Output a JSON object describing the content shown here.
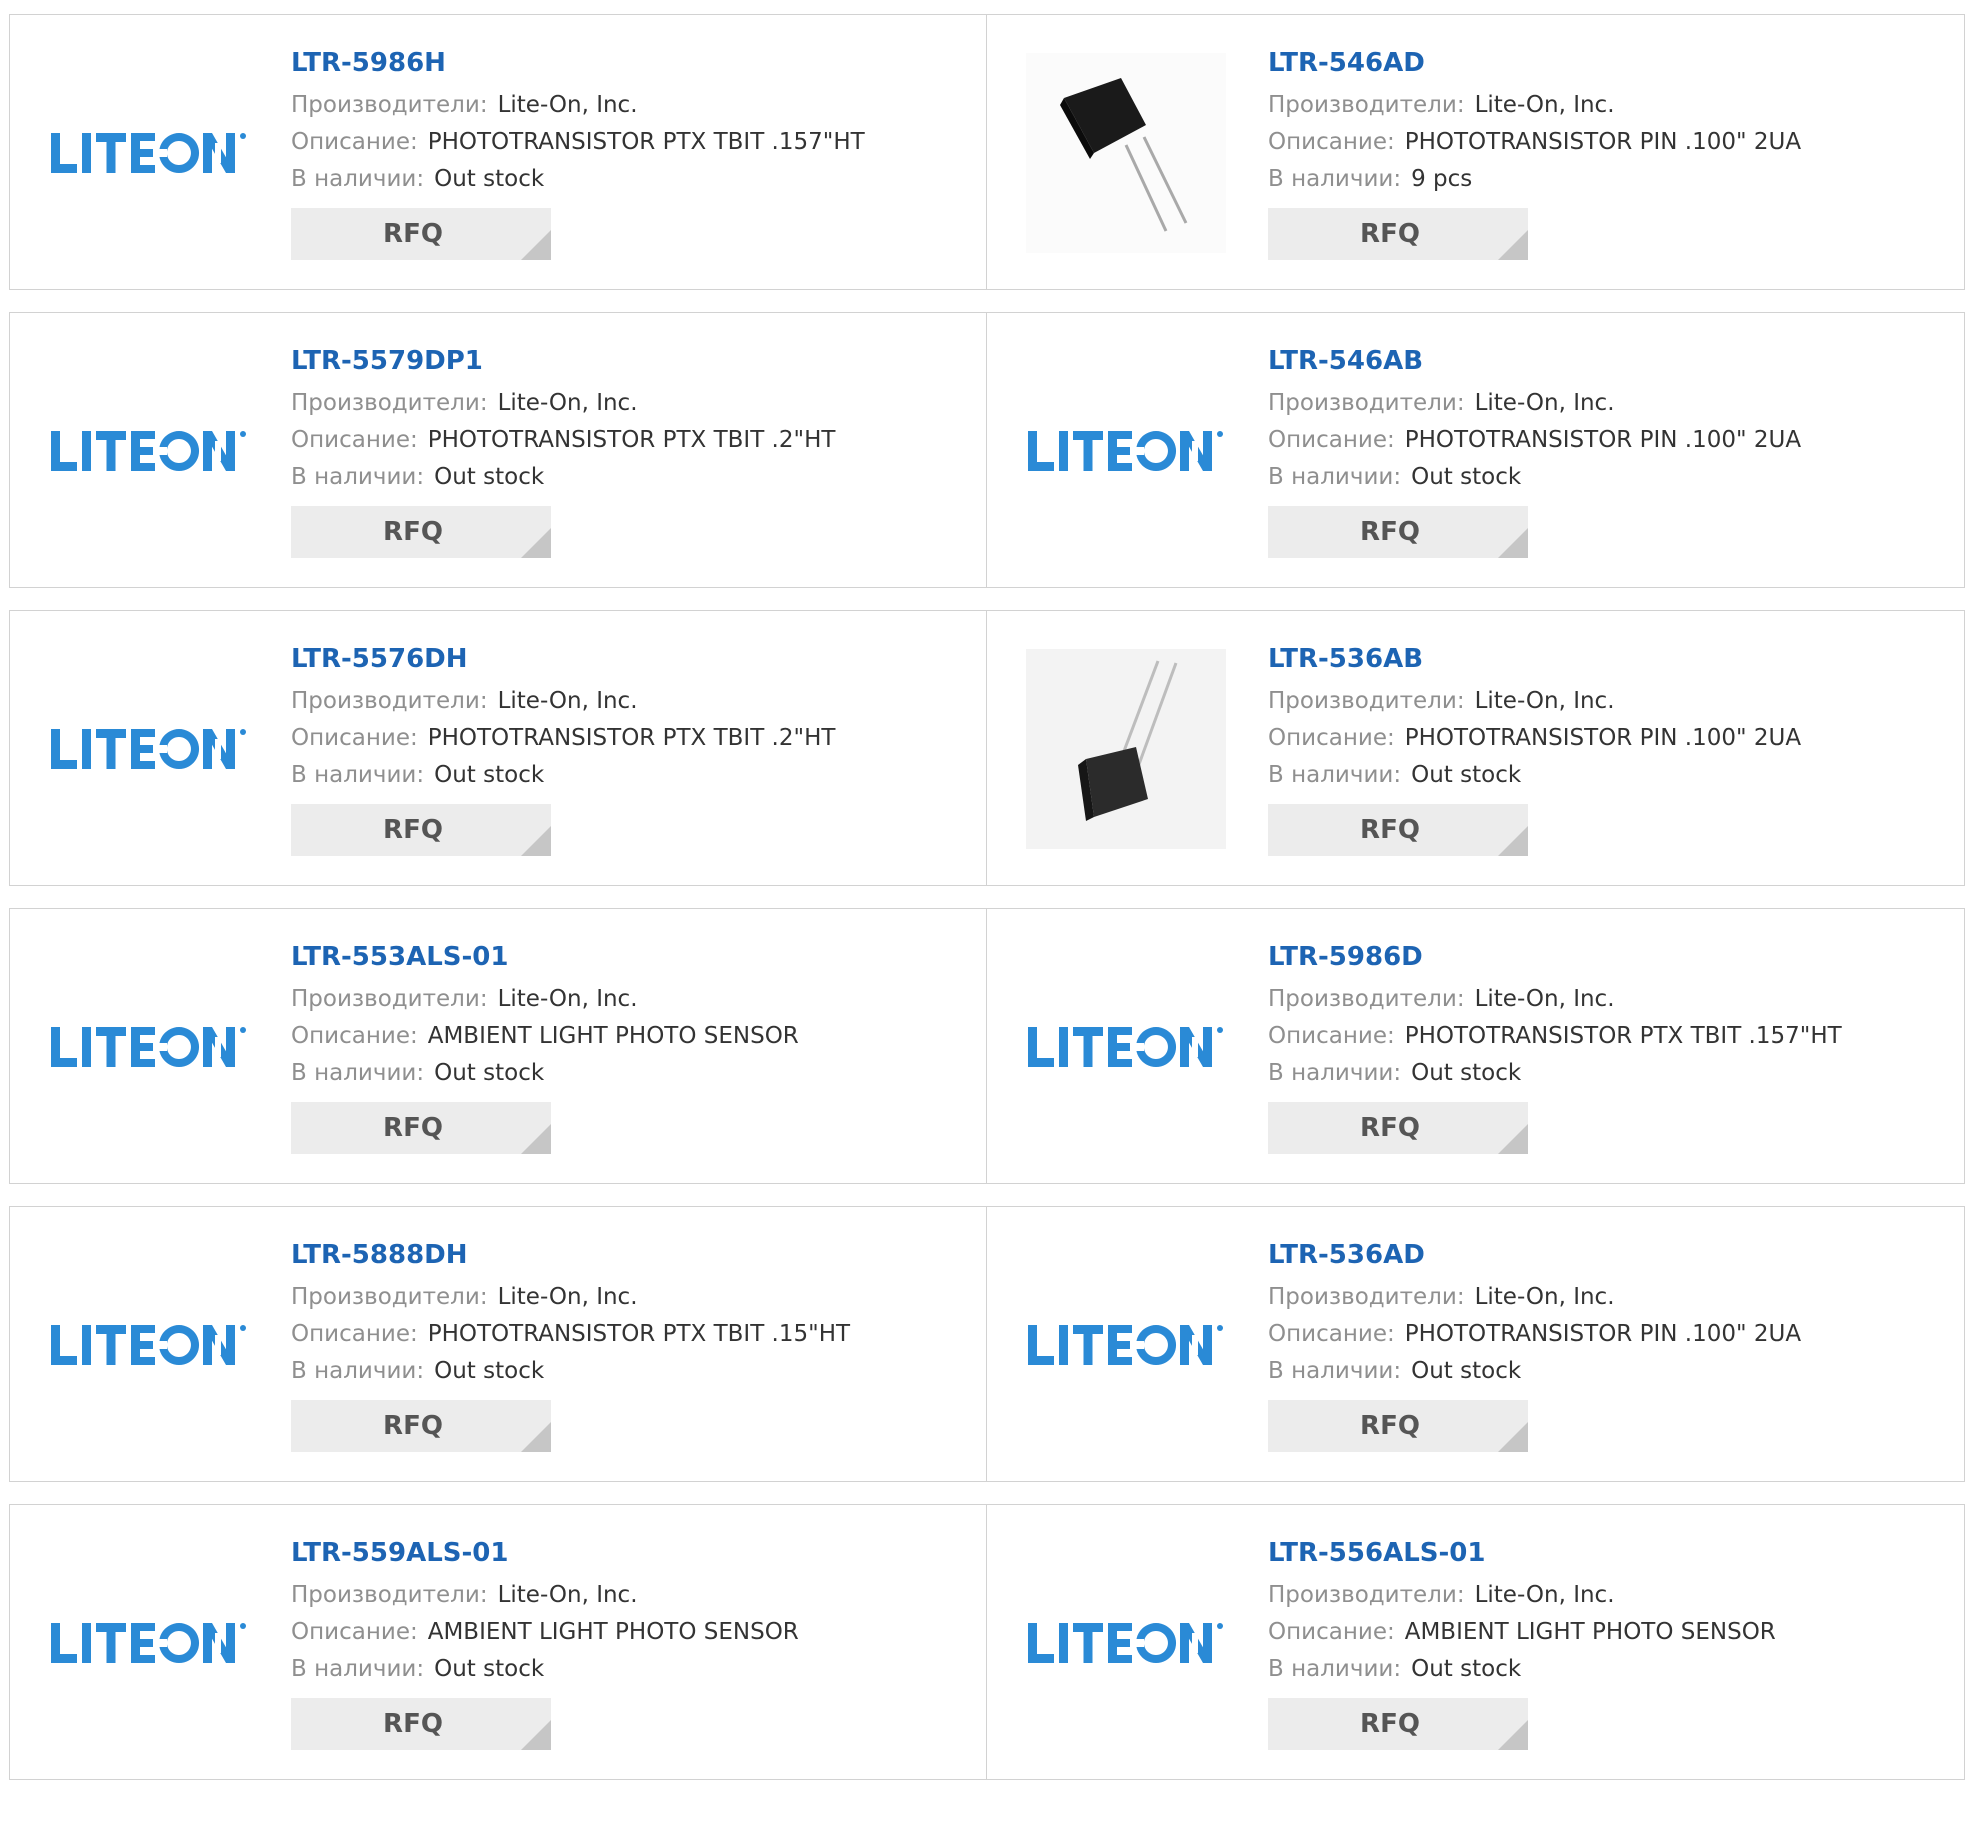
{
  "labels": {
    "manufacturer": "Производители:",
    "description": "Описание:",
    "stock": "В наличии:",
    "rfq": "RFQ"
  },
  "brand": {
    "logo_text": "LITEON",
    "accent_color": "#2a8ad6"
  },
  "products": [
    {
      "part": "LTR-5986H",
      "manufacturer": "Lite-On, Inc.",
      "description": "PHOTOTRANSISTOR PTX TBIT .157\"HT",
      "stock": "Out stock",
      "image": "liteon-logo"
    },
    {
      "part": "LTR-546AD",
      "manufacturer": "Lite-On, Inc.",
      "description": "PHOTOTRANSISTOR PIN .100\" 2UA",
      "stock": "9 pcs",
      "image": "phototransistor-photo"
    },
    {
      "part": "LTR-5579DP1",
      "manufacturer": "Lite-On, Inc.",
      "description": "PHOTOTRANSISTOR PTX TBIT .2\"HT",
      "stock": "Out stock",
      "image": "liteon-logo"
    },
    {
      "part": "LTR-546AB",
      "manufacturer": "Lite-On, Inc.",
      "description": "PHOTOTRANSISTOR PIN .100\" 2UA",
      "stock": "Out stock",
      "image": "liteon-logo"
    },
    {
      "part": "LTR-5576DH",
      "manufacturer": "Lite-On, Inc.",
      "description": "PHOTOTRANSISTOR PTX TBIT .2\"HT",
      "stock": "Out stock",
      "image": "liteon-logo"
    },
    {
      "part": "LTR-536AB",
      "manufacturer": "Lite-On, Inc.",
      "description": "PHOTOTRANSISTOR PIN .100\" 2UA",
      "stock": "Out stock",
      "image": "phototransistor-photo"
    },
    {
      "part": "LTR-553ALS-01",
      "manufacturer": "Lite-On, Inc.",
      "description": "AMBIENT LIGHT PHOTO SENSOR",
      "stock": "Out stock",
      "image": "liteon-logo"
    },
    {
      "part": "LTR-5986D",
      "manufacturer": "Lite-On, Inc.",
      "description": "PHOTOTRANSISTOR PTX TBIT .157\"HT",
      "stock": "Out stock",
      "image": "liteon-logo"
    },
    {
      "part": "LTR-5888DH",
      "manufacturer": "Lite-On, Inc.",
      "description": "PHOTOTRANSISTOR PTX TBIT .15\"HT",
      "stock": "Out stock",
      "image": "liteon-logo"
    },
    {
      "part": "LTR-536AD",
      "manufacturer": "Lite-On, Inc.",
      "description": "PHOTOTRANSISTOR PIN .100\" 2UA",
      "stock": "Out stock",
      "image": "liteon-logo"
    },
    {
      "part": "LTR-559ALS-01",
      "manufacturer": "Lite-On, Inc.",
      "description": "AMBIENT LIGHT PHOTO SENSOR",
      "stock": "Out stock",
      "image": "liteon-logo"
    },
    {
      "part": "LTR-556ALS-01",
      "manufacturer": "Lite-On, Inc.",
      "description": "AMBIENT LIGHT PHOTO SENSOR",
      "stock": "Out stock",
      "image": "liteon-logo"
    }
  ]
}
